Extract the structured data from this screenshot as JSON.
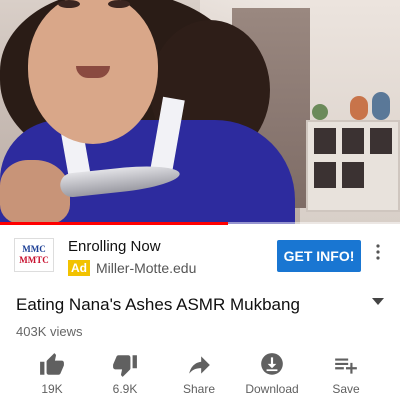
{
  "video": {
    "progress_percent": 57
  },
  "ad": {
    "logo_line1": "MMC",
    "logo_line2": "MMTC",
    "title": "Enrolling Now",
    "badge": "Ad",
    "url": "Miller-Motte.edu",
    "cta_label": "GET INFO!",
    "more_icon": "more-vert-icon"
  },
  "video_info": {
    "title": "Eating Nana's Ashes ASMR Mukbang",
    "views": "403K views",
    "expand_icon": "caret-down-icon"
  },
  "actions": [
    {
      "icon": "thumb-up-icon",
      "label": "19K"
    },
    {
      "icon": "thumb-down-icon",
      "label": "6.9K"
    },
    {
      "icon": "share-icon",
      "label": "Share"
    },
    {
      "icon": "download-icon",
      "label": "Download"
    },
    {
      "icon": "playlist-add-icon",
      "label": "Save"
    }
  ],
  "colors": {
    "cta": "#1976d2",
    "ad_badge": "#f2c200",
    "progress": "#ff0000"
  }
}
